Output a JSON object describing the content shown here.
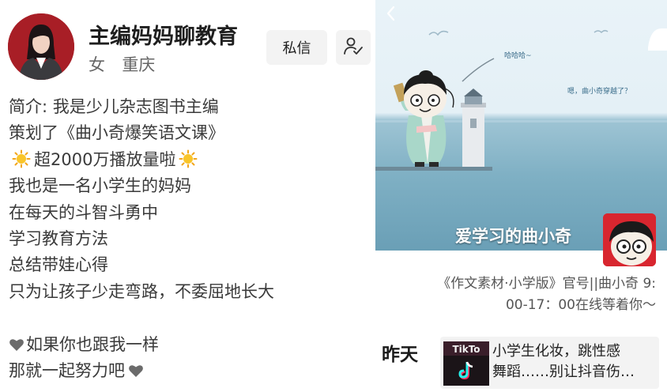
{
  "profile": {
    "name": "主编妈妈聊教育",
    "gender": "女",
    "location": "重庆",
    "message_label": "私信"
  },
  "bio": {
    "line1": "简介: 我是少儿杂志图书主编",
    "line2": "策划了《曲小奇爆笑语文课》",
    "line3": "超2000万播放量啦",
    "line4": "我也是一名小学生的妈妈",
    "line5": "在每天的斗智斗勇中",
    "line6": "学习教育方法",
    "line7": "总结带娃心得",
    "line8": "只为让孩子少走弯路，不委屈地长大",
    "line9": "如果你也跟我一样",
    "line10": "那就一起努力吧"
  },
  "video": {
    "cover_title": "爱学习的曲小奇",
    "cover_haha": "哈哈哈~",
    "cover_question": "嗯，曲小奇穿越了？",
    "caption_line1": "《作文素材·小学版》官号||曲小奇 9:",
    "caption_line2": "00-17：00在线等着你～"
  },
  "feed": {
    "date_label": "昨天",
    "news_line1": "小学生化妆，跳性感",
    "news_line2": "舞蹈……别让抖音伤…",
    "thumb_text": "TikTo"
  },
  "icons": {
    "back": "chevron-left-icon",
    "follow": "user-check-icon",
    "sun": "sun-emoji-icon",
    "heart": "heart-icon",
    "tiktok": "tiktok-logo-icon"
  },
  "colors": {
    "avatar_bg": "#a81e26",
    "cover_sky": "#e9f3f8",
    "cover_sea": "#7fb0c4",
    "button_bg": "#f3f3f3"
  }
}
